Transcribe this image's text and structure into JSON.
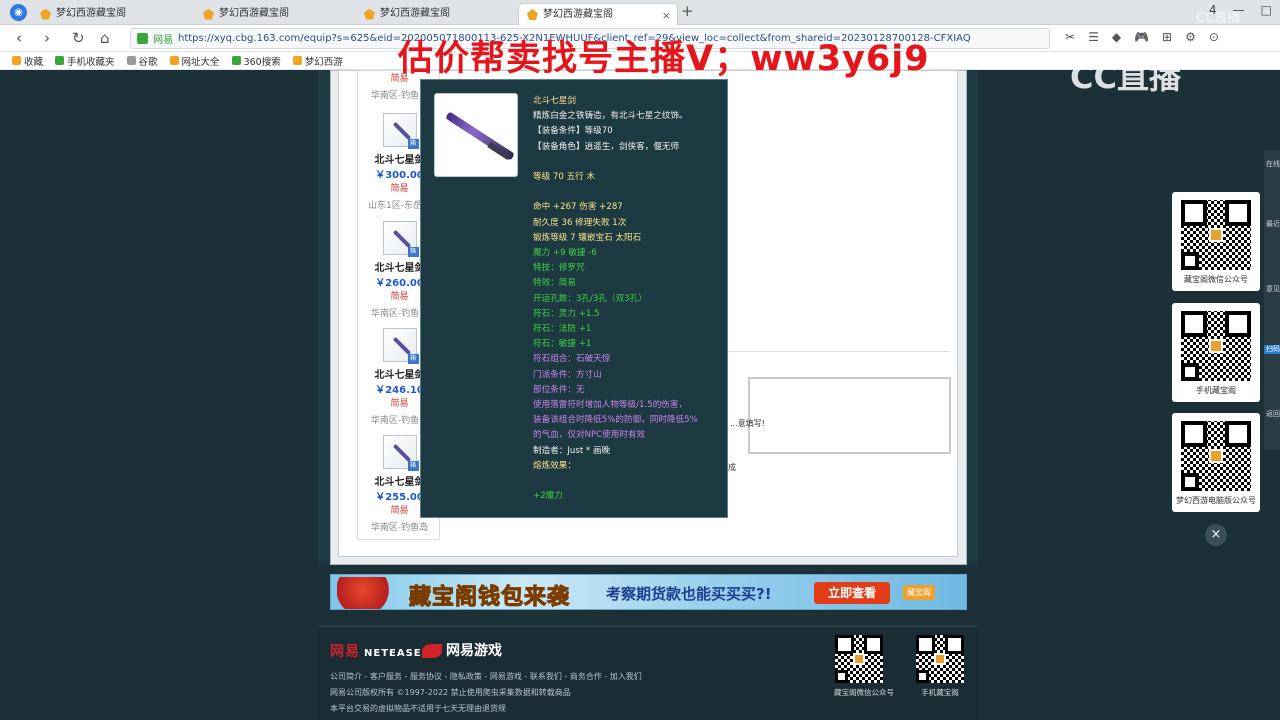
{
  "browser": {
    "tabs": [
      {
        "label": "梦幻西游藏宝阁",
        "active": false
      },
      {
        "label": "梦幻西游藏宝阁",
        "active": false
      },
      {
        "label": "梦幻西游藏宝阁",
        "active": false
      },
      {
        "label": "梦幻西游藏宝阁",
        "active": true
      }
    ],
    "close_glyph": "×",
    "new_tab_glyph": "+",
    "window_buttons": [
      "4",
      "—",
      "□"
    ],
    "nav": {
      "back": "‹",
      "forward": "›",
      "reload": "↻",
      "home": "⌂"
    },
    "site_tag": "网易",
    "url": "https://xyq.cbg.163.com/equip?s=625&eid=202005071800113-625-X2N1EWHUUF&client_ref=29&view_loc=collect&from_shareid=20230128700128-CFXIAQ",
    "tool_icons": [
      "✂",
      "☰",
      "◆",
      "🎮",
      "⊞",
      "⚙",
      "⊙"
    ],
    "bookmarks": [
      {
        "label": "收藏",
        "color": "#f0a422"
      },
      {
        "label": "手机收藏夹",
        "color": "#3aa53a"
      },
      {
        "label": "谷歌",
        "color": "#999999"
      },
      {
        "label": "网址大全",
        "color": "#f0a422"
      },
      {
        "label": "360搜索",
        "color": "#3aa53a"
      },
      {
        "label": "梦幻西游",
        "color": "#f0a422"
      }
    ]
  },
  "overlay": {
    "title": "估价帮卖找号主播V；ww3y6j9",
    "watermark": "CC直播",
    "watermark_small": "CC直播"
  },
  "item_list": [
    {
      "name": "",
      "price": "",
      "status": "简易",
      "server": "华南区-钓鱼岛",
      "partial": true
    },
    {
      "name": "北斗七星剑",
      "price": "￥300.00",
      "status": "简易",
      "server": "山东1区-东岳庙"
    },
    {
      "name": "北斗七星剑",
      "price": "￥260.00",
      "status": "简易",
      "server": "华南区-钓鱼岛"
    },
    {
      "name": "北斗七星剑",
      "price": "￥246.10",
      "status": "简易",
      "server": "华南区-钓鱼岛"
    },
    {
      "name": "北斗七星剑",
      "price": "￥255.00",
      "status": "简易",
      "server": "华南区-钓鱼岛"
    }
  ],
  "badge_text": "箱",
  "detail_note": "...意填写!",
  "detail_note2": "成",
  "tooltip": {
    "lines": [
      {
        "text": "北斗七星剑",
        "color": "yellow"
      },
      {
        "text": "精炼白金之铁铸造，有北斗七星之纹饰。",
        "color": "white"
      },
      {
        "text": "【装备条件】等级70",
        "color": "white"
      },
      {
        "text": "【装备角色】逍遥生，剑侠客，偃无师",
        "color": "white"
      },
      {
        "text": "",
        "color": "blank"
      },
      {
        "text": "等级 70  五行 木",
        "color": "yellow"
      },
      {
        "text": "",
        "color": "blank"
      },
      {
        "text": "命中 +267  伤害 +287",
        "color": "yellow"
      },
      {
        "text": "耐久度 36  修理失败 1次",
        "color": "yellow"
      },
      {
        "text": "锻炼等级 7  镶嵌宝石 太阳石",
        "color": "yellow"
      },
      {
        "text": "魔力 +9  敏捷 -6",
        "color": "green"
      },
      {
        "text": "特技：修罗咒",
        "color": "green"
      },
      {
        "text": "特效：简易",
        "color": "green"
      },
      {
        "text": "开运孔数：3孔/3孔（双3孔）",
        "color": "green"
      },
      {
        "text": "符石：灵力 +1.5",
        "color": "green"
      },
      {
        "text": "符石：法防 +1",
        "color": "green"
      },
      {
        "text": "符石：敏捷 +1",
        "color": "green"
      },
      {
        "text": "符石组合：石破天惊",
        "color": "purple"
      },
      {
        "text": "门派条件：方寸山",
        "color": "purple"
      },
      {
        "text": "部位条件：无",
        "color": "purple"
      },
      {
        "text": "使用落雷符时增加人物等级/1.5的伤害，",
        "color": "purple"
      },
      {
        "text": "装备该组合时降低5%的防御，同时降低5%",
        "color": "purple"
      },
      {
        "text": "的气血，仅对NPC使用时有效",
        "color": "purple"
      },
      {
        "text": "制造者：Just * 画晚",
        "color": "white"
      },
      {
        "text": "熔炼效果：",
        "color": "yellow"
      },
      {
        "text": "",
        "color": "blank"
      },
      {
        "text": "+2魔力",
        "color": "green"
      }
    ]
  },
  "right_panel": {
    "qr_cards": [
      {
        "label": "藏宝阁微信公众号"
      },
      {
        "label": "手机藏宝阁"
      },
      {
        "label": "梦幻西游电脑版公众号"
      }
    ],
    "close_glyph": "×",
    "side_items": [
      "在线 精灵",
      "最近 浏览",
      "意见 反馈",
      "扫码 下载",
      "返回 顶部"
    ]
  },
  "banner": {
    "title": "藏宝阁钱包来袭",
    "subtitle": "考察期货款也能买买买?!",
    "button": "立即查看",
    "logo": "藏宝阁"
  },
  "footer": {
    "logo_netease_cn": "网易",
    "logo_netease_en": "NETEASE",
    "logo_games": "网易游戏",
    "links": "公司简介 - 客户服务 - 服务协议 - 隐私政策 - 网易游戏 - 联系我们 - 商务合作 - 加入我们",
    "copyright": "网易公司版权所有 ©1997-2022  禁止使用爬虫采集数据和转载商品",
    "notice": "本平台交易的虚拟物品不适用于七天无理由退货规",
    "qr1_label": "藏宝阁微信公众号",
    "qr2_label": "手机藏宝阁"
  }
}
